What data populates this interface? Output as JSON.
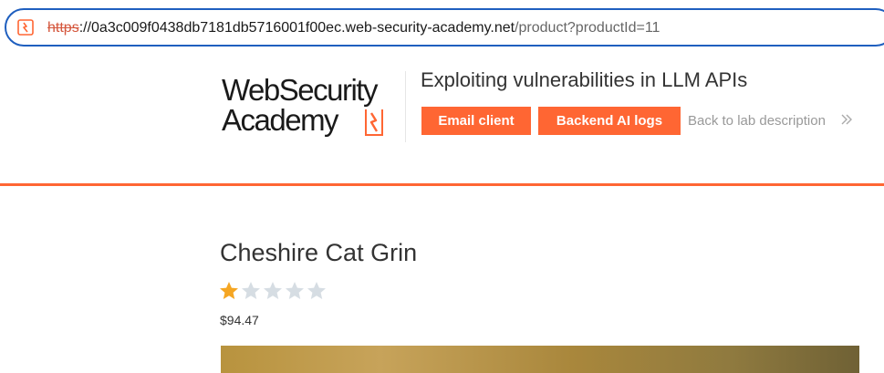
{
  "address_bar": {
    "scheme": "https",
    "host_prefix": "://0a3c009f0438db7181db5716001f00ec.web-security-academy.net",
    "path": "/product?productId=11"
  },
  "header": {
    "logo_line1": "WebSecurity",
    "logo_line2": "Academy",
    "lab_title": "Exploiting vulnerabilities in LLM APIs",
    "email_client_label": "Email client",
    "backend_logs_label": "Backend AI logs",
    "back_link_label": "Back to lab description"
  },
  "product": {
    "title": "Cheshire Cat Grin",
    "rating": {
      "value": 1,
      "max": 5
    },
    "price": "$94.47"
  },
  "colors": {
    "accent": "#ff6633",
    "star_filled": "#f5a623",
    "star_empty": "#d6dde3",
    "url_border": "#1f5fbf"
  },
  "icons": {
    "site_icon": "lab-logo-icon",
    "back_icon": "double-chevron-right-icon",
    "star_icon": "star-icon"
  }
}
